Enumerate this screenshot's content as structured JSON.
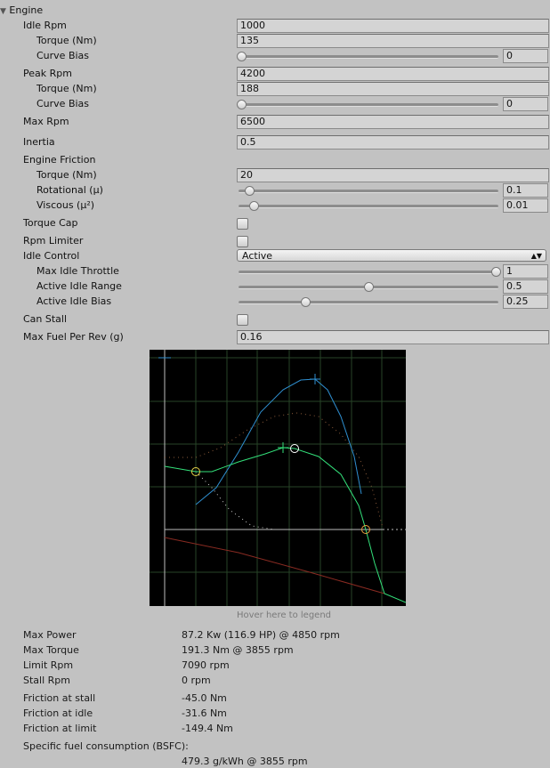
{
  "section": {
    "title": "Engine",
    "expanded": true
  },
  "fields": {
    "idle_rpm": {
      "label": "Idle Rpm",
      "value": "1000"
    },
    "idle_torque": {
      "label": "Torque (Nm)",
      "value": "135"
    },
    "idle_curve_bias": {
      "label": "Curve Bias",
      "value": "0",
      "slider_fraction": 0
    },
    "peak_rpm": {
      "label": "Peak Rpm",
      "value": "4200"
    },
    "peak_torque": {
      "label": "Torque (Nm)",
      "value": "188"
    },
    "peak_curve_bias": {
      "label": "Curve Bias",
      "value": "0",
      "slider_fraction": 0
    },
    "max_rpm": {
      "label": "Max Rpm",
      "value": "6500"
    },
    "inertia": {
      "label": "Inertia",
      "value": "0.5"
    },
    "engine_friction": {
      "label": "Engine Friction"
    },
    "friction_torque": {
      "label": "Torque (Nm)",
      "value": "20"
    },
    "rotational": {
      "label": "Rotational (μ)",
      "value": "0.1",
      "slider_fraction": 0.03
    },
    "viscous": {
      "label": "Viscous (μ²)",
      "value": "0.01",
      "slider_fraction": 0.05
    },
    "torque_cap": {
      "label": "Torque Cap",
      "checked": false
    },
    "rpm_limiter": {
      "label": "Rpm Limiter",
      "checked": false
    },
    "idle_control": {
      "label": "Idle Control",
      "value": "Active"
    },
    "max_idle_throttle": {
      "label": "Max Idle Throttle",
      "value": "1",
      "slider_fraction": 1
    },
    "active_idle_range": {
      "label": "Active Idle Range",
      "value": "0.5",
      "slider_fraction": 0.5
    },
    "active_idle_bias": {
      "label": "Active Idle Bias",
      "value": "0.25",
      "slider_fraction": 0.25
    },
    "can_stall": {
      "label": "Can Stall",
      "checked": false
    },
    "max_fuel_per_rev": {
      "label": "Max Fuel Per Rev (g)",
      "value": "0.16"
    }
  },
  "graph": {
    "hover_hint": "Hover here to legend",
    "colors": {
      "torque": "#33e07a",
      "power": "#2f8fd0",
      "friction": "#8a2b22",
      "fuel": "#8a5a3a",
      "grid": "#2a4a2a"
    }
  },
  "stats": [
    {
      "label": "Max Power",
      "value": "87.2 Kw (116.9 HP) @ 4850 rpm"
    },
    {
      "label": "Max Torque",
      "value": "191.3 Nm @ 3855 rpm"
    },
    {
      "label": "Limit Rpm",
      "value": "7090 rpm"
    },
    {
      "label": "Stall Rpm",
      "value": "0 rpm"
    },
    {
      "label": "Friction at stall",
      "value": "-45.0 Nm"
    },
    {
      "label": "Friction at idle",
      "value": "-31.6 Nm"
    },
    {
      "label": "Friction at limit",
      "value": "-149.4 Nm"
    },
    {
      "label": "Specific fuel consumption (BSFC):",
      "value": "479.3 g/kWh @ 3855 rpm"
    }
  ]
}
